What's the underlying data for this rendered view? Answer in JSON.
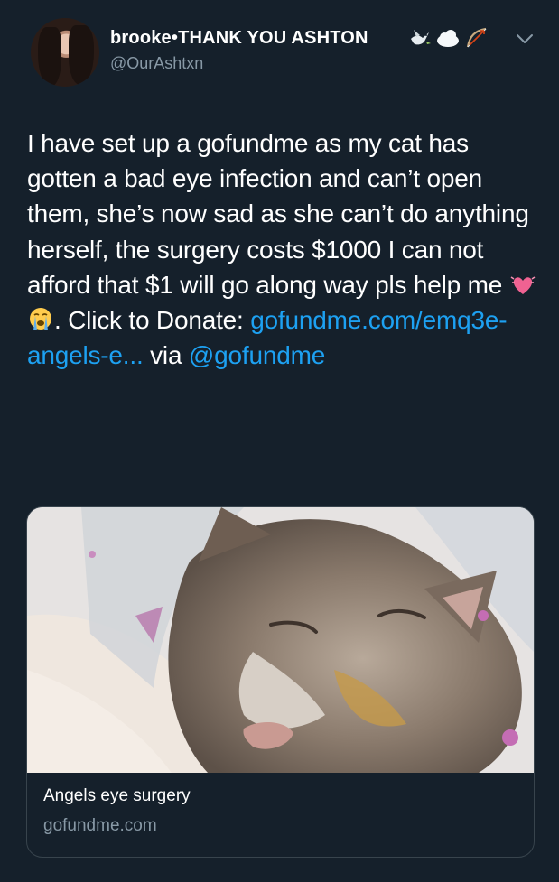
{
  "tweet": {
    "author": {
      "display_name": "brooke•THANK YOU ASHTON",
      "name_emojis": [
        "dove-icon",
        "cloud-icon",
        "bow-and-arrow-icon"
      ],
      "handle": "@OurAshtxn"
    },
    "text": {
      "part1": "I have set up a gofundme as my cat has gotten a bad eye infection and can’t open them, she’s now sad as she can’t do anything herself, the surgery costs $1000 I can not afford that $1 will go along way pls help me ",
      "emojis": [
        "heart-pulse-icon",
        "loudly-crying-face-icon"
      ],
      "part2": ". Click to Donate:  ",
      "link": "gofundme.com/emq3e-angels-e...",
      "part3": " via ",
      "mention": "@gofundme"
    },
    "card": {
      "title": "Angels eye surgery",
      "domain": "gofundme.com"
    }
  },
  "colors": {
    "background": "#15202b",
    "text": "#ffffff",
    "secondary": "#8899a6",
    "link": "#1da1f2",
    "border": "#38444d"
  }
}
